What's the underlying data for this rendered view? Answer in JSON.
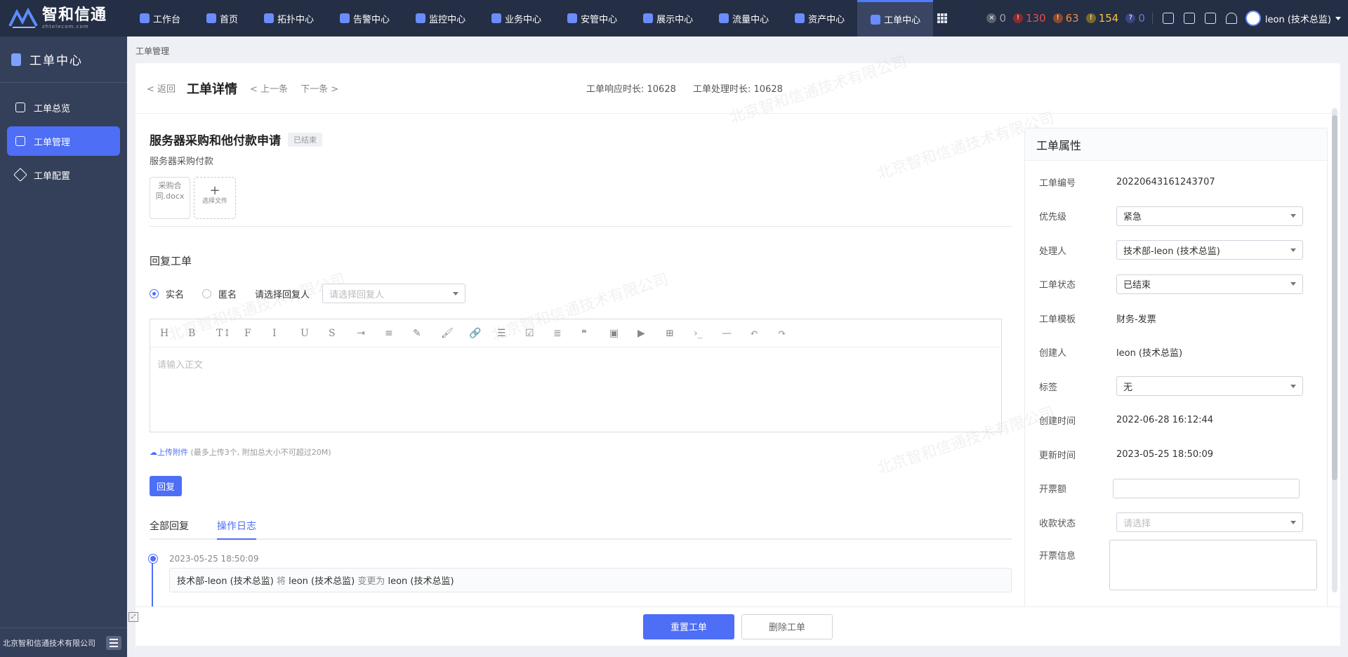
{
  "brand": {
    "name": "智和信通",
    "sub": "zhtelecom.com"
  },
  "nav": [
    {
      "label": "工作台",
      "icon": "workbench-icon"
    },
    {
      "label": "首页",
      "icon": "home-icon"
    },
    {
      "label": "拓扑中心",
      "icon": "topology-icon"
    },
    {
      "label": "告警中心",
      "icon": "alarm-icon"
    },
    {
      "label": "监控中心",
      "icon": "monitor-icon"
    },
    {
      "label": "业务中心",
      "icon": "business-icon"
    },
    {
      "label": "安管中心",
      "icon": "security-icon"
    },
    {
      "label": "展示中心",
      "icon": "display-icon"
    },
    {
      "label": "流量中心",
      "icon": "traffic-icon"
    },
    {
      "label": "资产中心",
      "icon": "asset-icon"
    },
    {
      "label": "工单中心",
      "icon": "ticket-icon"
    }
  ],
  "alarms": [
    {
      "value": "0",
      "color": "#9aa0b0",
      "icon": "x"
    },
    {
      "value": "130",
      "color": "#e2504c",
      "icon": "!"
    },
    {
      "value": "63",
      "color": "#f08a3e",
      "icon": "!"
    },
    {
      "value": "154",
      "color": "#f5c242",
      "icon": "!"
    },
    {
      "value": "0",
      "color": "#6b7bd6",
      "icon": "?"
    }
  ],
  "user": {
    "name": "leon (技术总监)"
  },
  "sidebar": {
    "title": "工单中心",
    "items": [
      {
        "label": "工单总览",
        "icon": "home-icon"
      },
      {
        "label": "工单管理",
        "icon": "list-icon"
      },
      {
        "label": "工单配置",
        "icon": "wrench-icon"
      }
    ],
    "footer": "北京智和信通技术有限公司"
  },
  "breadcrumb": "工单管理",
  "header": {
    "back": "< 返回",
    "title": "工单详情",
    "prev": "< 上一条",
    "next": "下一条 >",
    "response_time": "工单响应时长: 10628",
    "handle_time": "工单处理时长: 10628"
  },
  "ticket": {
    "title": "服务器采购和他付款申请",
    "status_badge": "已结束",
    "desc": "服务器采购付款",
    "file_name": "采购合同.docx",
    "add_file": "选择文件"
  },
  "reply": {
    "title": "回复工单",
    "opt_real": "实名",
    "opt_anon": "匿名",
    "replier_label": "请选择回复人",
    "replier_placeholder": "请选择回复人",
    "editor_placeholder": "请输入正文",
    "upload_link": "上传附件",
    "upload_hint": "(最多上传3个, 附加总大小不可超过20M)",
    "button": "回复"
  },
  "toolbar_icons": [
    "H",
    "B",
    "T↕",
    "F",
    "I",
    "U",
    "S",
    "⇥",
    "≡",
    "✎",
    "🖌",
    "🔗",
    "☰",
    "☑",
    "≣",
    "❝",
    "▣",
    "▶",
    "⊞",
    "›_",
    "—",
    "↶",
    "↷"
  ],
  "tabs": [
    {
      "label": "全部回复"
    },
    {
      "label": "操作日志"
    }
  ],
  "log": {
    "time": "2023-05-25 18:50:09",
    "who": "技术部-leon (技术总监)",
    "w1": "将",
    "from": "leon (技术总监)",
    "w2": "变更为",
    "to": "leon (技术总监)"
  },
  "props": {
    "title": "工单属性",
    "rows": [
      {
        "k": "工单编号",
        "v": "20220643161243707"
      },
      {
        "k": "优先级",
        "v": "紧急"
      },
      {
        "k": "处理人",
        "v": "技术部-leon (技术总监)"
      },
      {
        "k": "工单状态",
        "v": "已结束"
      },
      {
        "k": "工单模板",
        "v": "财务-发票"
      },
      {
        "k": "创建人",
        "v": "leon (技术总监)"
      },
      {
        "k": "标签",
        "v": "无"
      },
      {
        "k": "创建时间",
        "v": "2022-06-28 16:12:44"
      },
      {
        "k": "更新时间",
        "v": "2023-05-25 18:50:09"
      },
      {
        "k": "开票额",
        "v": ""
      },
      {
        "k": "收款状态",
        "v": "请选择"
      },
      {
        "k": "开票信息",
        "v": ""
      }
    ]
  },
  "footer_buttons": {
    "reopen": "重置工单",
    "delete": "删除工单"
  },
  "watermark": "北京智和信通技术有限公司"
}
